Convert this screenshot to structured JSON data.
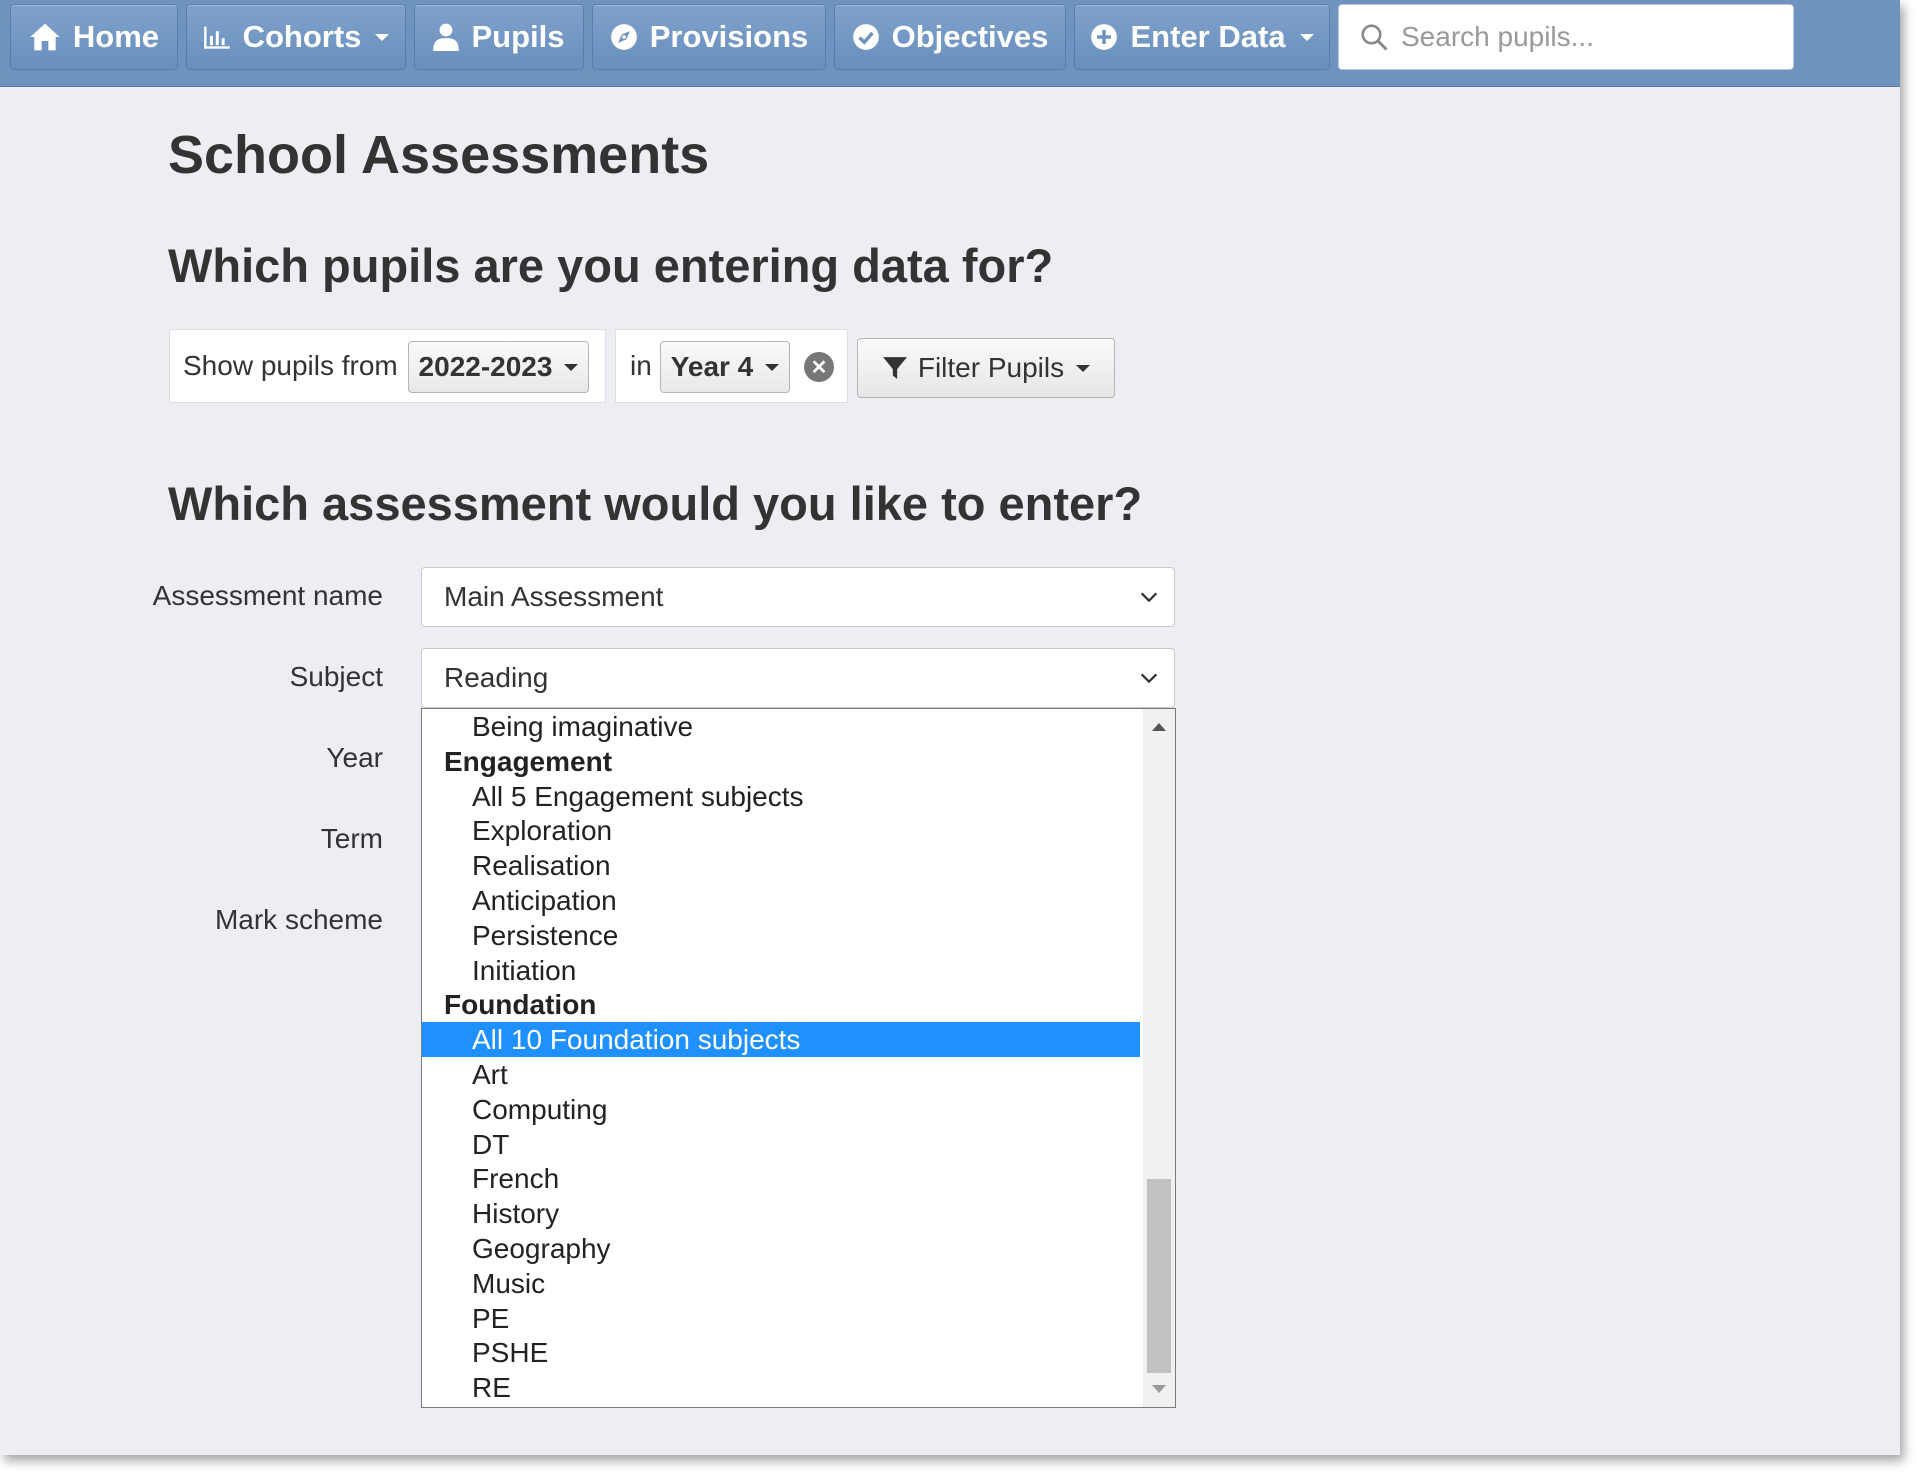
{
  "navbar": {
    "items": [
      {
        "label": "Home",
        "icon": "home-icon",
        "caret": false
      },
      {
        "label": "Cohorts",
        "icon": "bar-chart-icon",
        "caret": true
      },
      {
        "label": "Pupils",
        "icon": "user-icon",
        "caret": false
      },
      {
        "label": "Provisions",
        "icon": "compass-icon",
        "caret": false
      },
      {
        "label": "Objectives",
        "icon": "check-circle-icon",
        "caret": false
      },
      {
        "label": "Enter Data",
        "icon": "plus-circle-icon",
        "caret": true
      }
    ],
    "search_placeholder": "Search pupils..."
  },
  "page_title": "School Assessments",
  "pupils_section": {
    "heading": "Which pupils are you entering data for?",
    "show_from_label": "Show pupils from",
    "year_range": "2022-2023",
    "in_label": "in",
    "year_group": "Year 4",
    "filter_button": "Filter Pupils"
  },
  "assessment_section": {
    "heading": "Which assessment would you like to enter?",
    "fields": {
      "assessment_name_label": "Assessment name",
      "assessment_name_value": "Main Assessment",
      "subject_label": "Subject",
      "subject_value": "Reading",
      "year_label": "Year",
      "term_label": "Term",
      "mark_scheme_label": "Mark scheme"
    },
    "subject_options": [
      {
        "label": "Being imaginative",
        "type": "child"
      },
      {
        "label": "Engagement",
        "type": "group"
      },
      {
        "label": "All 5 Engagement subjects",
        "type": "child"
      },
      {
        "label": "Exploration",
        "type": "child"
      },
      {
        "label": "Realisation",
        "type": "child"
      },
      {
        "label": "Anticipation",
        "type": "child"
      },
      {
        "label": "Persistence",
        "type": "child"
      },
      {
        "label": "Initiation",
        "type": "child"
      },
      {
        "label": "Foundation",
        "type": "group"
      },
      {
        "label": "All 10 Foundation subjects",
        "type": "child",
        "selected": true
      },
      {
        "label": "Art",
        "type": "child"
      },
      {
        "label": "Computing",
        "type": "child"
      },
      {
        "label": "DT",
        "type": "child"
      },
      {
        "label": "French",
        "type": "child"
      },
      {
        "label": "History",
        "type": "child"
      },
      {
        "label": "Geography",
        "type": "child"
      },
      {
        "label": "Music",
        "type": "child"
      },
      {
        "label": "PE",
        "type": "child"
      },
      {
        "label": "PSHE",
        "type": "child"
      },
      {
        "label": "RE",
        "type": "child"
      }
    ]
  },
  "colors": {
    "navbar": "#6f93bf",
    "selected_option": "#1e90ff",
    "page_background": "#eceef3"
  }
}
